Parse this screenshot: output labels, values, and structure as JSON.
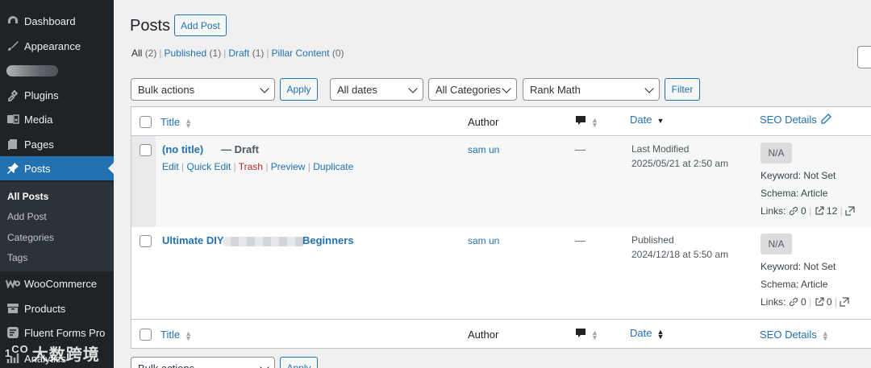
{
  "sidebar": {
    "items": [
      {
        "label": "Dashboard",
        "icon": "dashboard-icon"
      },
      {
        "label": "Appearance",
        "icon": "paintbrush-icon"
      },
      {
        "label": "",
        "icon": "blurred-item"
      },
      {
        "label": "Plugins",
        "icon": "plugin-icon"
      },
      {
        "label": "Media",
        "icon": "media-icon"
      },
      {
        "label": "Pages",
        "icon": "pages-icon"
      },
      {
        "label": "Posts",
        "icon": "pin-icon"
      },
      {
        "label": "WooCommerce",
        "icon": "woo-icon"
      },
      {
        "label": "Products",
        "icon": "archive-icon"
      },
      {
        "label": "Fluent Forms Pro",
        "icon": "forms-icon"
      },
      {
        "label": "Analytics",
        "icon": "chart-icon"
      }
    ],
    "submenu": [
      "All Posts",
      "Add Post",
      "Categories",
      "Tags"
    ]
  },
  "watermark": "大数跨境",
  "header": {
    "title": "Posts",
    "add_button": "Add Post"
  },
  "filters": {
    "views": [
      {
        "label": "All",
        "count": "(2)"
      },
      {
        "label": "Published",
        "count": "(1)"
      },
      {
        "label": "Draft",
        "count": "(1)"
      },
      {
        "label": "Pillar Content",
        "count": "(0)"
      }
    ],
    "bulk_actions": "Bulk actions",
    "apply": "Apply",
    "dates": "All dates",
    "categories": "All Categories",
    "rank_math": "Rank Math",
    "filter": "Filter"
  },
  "table": {
    "columns": {
      "title": "Title",
      "author": "Author",
      "date": "Date",
      "seo": "SEO Details"
    },
    "rows": [
      {
        "title": "(no title)",
        "state": "— Draft",
        "actions": [
          "Edit",
          "Quick Edit",
          "Trash",
          "Preview",
          "Duplicate"
        ],
        "author": "sam un",
        "comments": "—",
        "date_status": "Last Modified",
        "date_value": "2025/05/21 at 2:50 am",
        "seo_score": "N/A",
        "keyword": "Keyword: Not Set",
        "schema": "Schema: Article",
        "links_label": "Links:",
        "internal_links": "0",
        "external_links": "12"
      },
      {
        "title_start": "Ultimate DIY",
        "title_end": "Beginners",
        "author": "sam un",
        "comments": "—",
        "date_status": "Published",
        "date_value": "2024/12/18 at 5:50 am",
        "seo_score": "N/A",
        "keyword": "Keyword: Not Set",
        "schema": "Schema: Article",
        "links_label": "Links:",
        "internal_links": "0",
        "external_links": "0"
      }
    ]
  },
  "colors": {
    "sidebar": "#1d2327",
    "accent": "#2271b1",
    "trash": "#b32d2e"
  }
}
